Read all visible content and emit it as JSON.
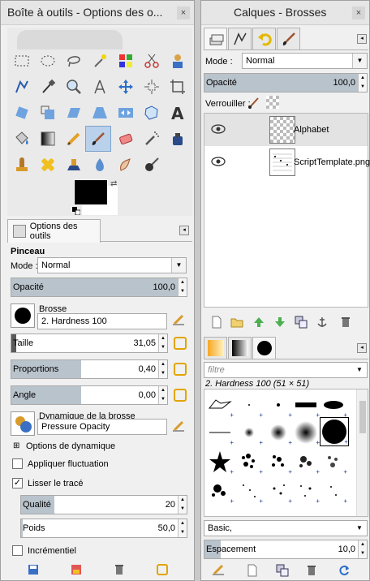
{
  "left_panel": {
    "title": "Boîte à outils - Options des o...",
    "close": "×",
    "tabs": [
      {
        "label": "Options des outils"
      }
    ],
    "section": "Pinceau",
    "mode_label": "Mode :",
    "mode_value": "Normal",
    "opacity_label": "Opacité",
    "opacity_value": "100,0",
    "opacity_fraction": 1.0,
    "brush_label": "Brosse",
    "brush_value": "2. Hardness 100",
    "size_label": "Taille",
    "size_value": "31,05",
    "size_fraction": 0.03,
    "ratio_label": "Proportions",
    "ratio_value": "0,40",
    "ratio_fraction": 0.45,
    "angle_label": "Angle",
    "angle_value": "0,00",
    "angle_fraction": 0.45,
    "dynamics_label": "Dynamique de la brosse",
    "dynamics_value": "Pressure Opacity",
    "dynamics_options_label": "Options de dynamique",
    "jitter_label": "Appliquer fluctuation",
    "jitter_checked": false,
    "smooth_label": "Lisser le tracé",
    "smooth_checked": true,
    "quality_label": "Qualité",
    "quality_value": "20",
    "quality_fraction": 0.2,
    "weight_label": "Poids",
    "weight_value": "50,0",
    "weight_fraction": 0.01,
    "incremental_label": "Incrémentiel",
    "incremental_checked": false
  },
  "right_panel": {
    "title": "Calques - Brosses",
    "close": "×",
    "mode_label": "Mode :",
    "mode_value": "Normal",
    "opacity_label": "Opacité",
    "opacity_value": "100,0",
    "opacity_fraction": 1.0,
    "lock_label": "Verrouiller :",
    "layers": [
      {
        "name": "Alphabet",
        "visible": true
      },
      {
        "name": "ScriptTemplate.png",
        "visible": true
      }
    ],
    "filter_placeholder": "filtre",
    "brush_name": "2. Hardness 100 (51 × 51)",
    "brush_category": "Basic,",
    "spacing_label": "Espacement",
    "spacing_value": "10,0",
    "spacing_fraction": 0.1
  },
  "colors": {
    "accent": "#b9d1ea",
    "slider_fill": "#b9c3cc",
    "chain": "#e2a400"
  }
}
